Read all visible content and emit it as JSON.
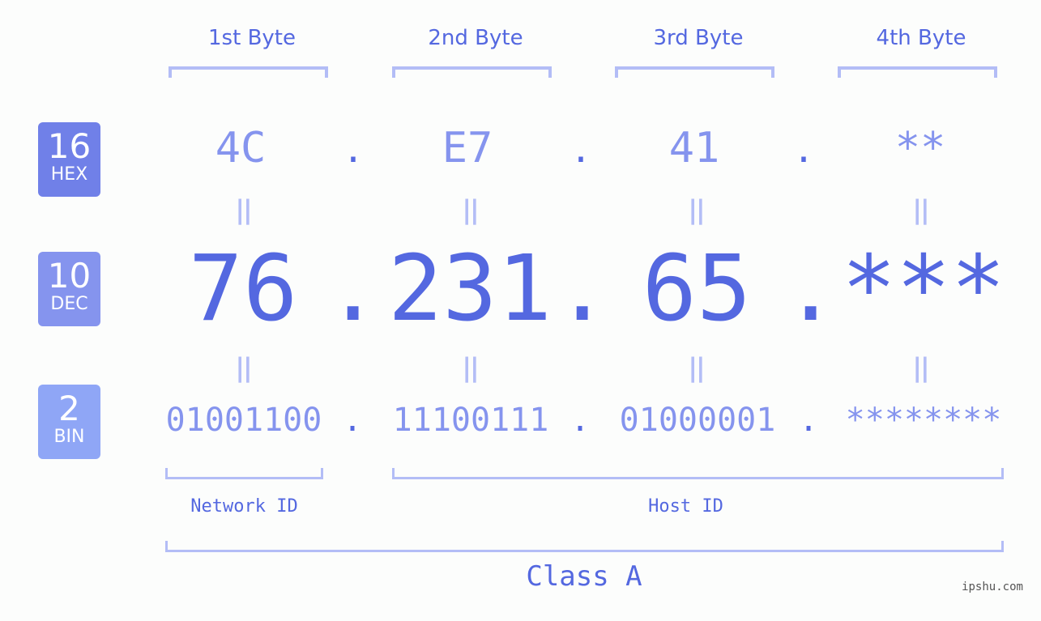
{
  "colors": {
    "primary": "#5468e0",
    "light_text": "#8594ee",
    "bracket": "#b3bdf6",
    "hex_badge": "#7080e8",
    "dec_badge": "#8594ee",
    "bin_badge": "#8fa6f6",
    "background": "#fcfdfc"
  },
  "byte_headers": [
    "1st Byte",
    "2nd Byte",
    "3rd Byte",
    "4th Byte"
  ],
  "rows": {
    "hex": {
      "badge_num": "16",
      "badge_label": "HEX",
      "values": [
        "4C",
        "E7",
        "41",
        "**"
      ]
    },
    "dec": {
      "badge_num": "10",
      "badge_label": "DEC",
      "values": [
        "76",
        "231",
        "65",
        "***"
      ]
    },
    "bin": {
      "badge_num": "2",
      "badge_label": "BIN",
      "values": [
        "01001100",
        "11100111",
        "01000001",
        "********"
      ]
    }
  },
  "separator": ".",
  "equals": "||",
  "network_id_label": "Network ID",
  "host_id_label": "Host ID",
  "class_label": "Class A",
  "watermark": "ipshu.com"
}
